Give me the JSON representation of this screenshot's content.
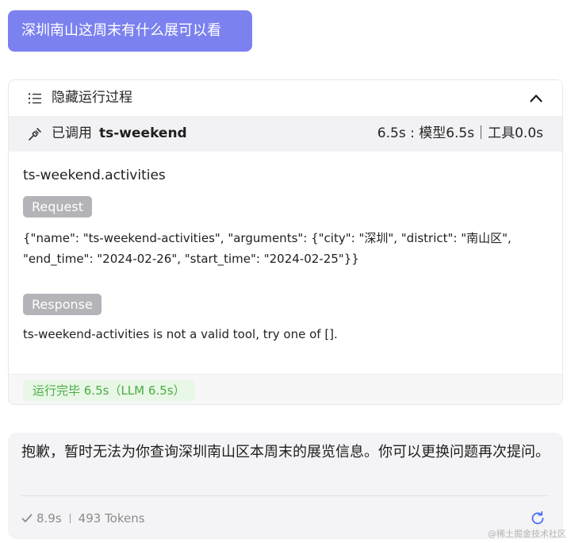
{
  "user_message": "深圳南山这周末有什么展可以看",
  "process": {
    "toggle_label": "隐藏运行过程",
    "tool_call": {
      "called_prefix": "已调用",
      "tool_name": "ts-weekend",
      "timing": "6.5s : 模型6.5s｜工具0.0s"
    },
    "function_name": "ts-weekend.activities",
    "request_tag": "Request",
    "request_body": "{\"name\": \"ts-weekend-activities\", \"arguments\": {\"city\": \"深圳\", \"district\": \"南山区\",\n\"end_time\": \"2024-02-26\", \"start_time\": \"2024-02-25\"}}",
    "response_tag": "Response",
    "response_body": "ts-weekend-activities is not a valid tool, try one of [].",
    "run_status": "运行完毕 6.5s（LLM 6.5s）"
  },
  "answer": {
    "text": "抱歉，暂时无法为你查询深圳南山区本周末的展览信息。你可以更换问题再次提问。",
    "duration": "8.9s",
    "tokens": "493 Tokens"
  },
  "watermark": "@稀土掘金技术社区",
  "colors": {
    "user_bubble": "#7b81ef",
    "status_green": "#4cac45",
    "status_green_bg": "#e8f7e6",
    "refresh_blue": "#4a6cf7"
  },
  "icons": {
    "list": "list-icon",
    "collapse": "chevron-up-icon",
    "tool": "tool-icon",
    "check": "check-icon",
    "refresh": "refresh-icon"
  }
}
